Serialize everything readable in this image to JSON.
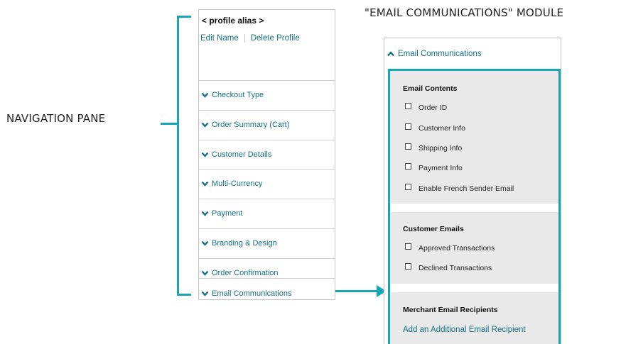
{
  "callouts": {
    "module_label": "\"EMAIL COMMUNICATIONS\" MODULE",
    "nav_label": "NAVIGATION PANE"
  },
  "colors": {
    "accent": "#16a6b6",
    "link": "#137184",
    "section_bg": "#e9e9e9"
  },
  "nav": {
    "profile_alias": "< profile alias >",
    "edit_name": "Edit Name",
    "delete_profile": "Delete Profile",
    "items": [
      {
        "label": "Checkout Type",
        "icon": "chevron-down-icon"
      },
      {
        "label": "Order Summary (Cart)",
        "icon": "chevron-down-icon"
      },
      {
        "label": "Customer Details",
        "icon": "chevron-down-icon"
      },
      {
        "label": "Multi-Currency",
        "icon": "chevron-down-icon"
      },
      {
        "label": "Payment",
        "icon": "chevron-down-icon"
      },
      {
        "label": "Branding & Design",
        "icon": "chevron-down-icon"
      },
      {
        "label": "Order Confirmation",
        "icon": "chevron-down-icon"
      },
      {
        "label": "Email Communications",
        "icon": "chevron-down-icon"
      }
    ]
  },
  "module": {
    "header": "Email Communications",
    "header_icon": "chevron-up-icon",
    "email_contents": {
      "title": "Email Contents",
      "options": [
        {
          "label": "Order ID",
          "checked": false
        },
        {
          "label": "Customer Info",
          "checked": false
        },
        {
          "label": "Shipping Info",
          "checked": false
        },
        {
          "label": "Payment Info",
          "checked": false
        },
        {
          "label": "Enable French Sender Email",
          "checked": false
        }
      ]
    },
    "customer_emails": {
      "title": "Customer Emails",
      "options": [
        {
          "label": "Approved Transactions",
          "checked": false
        },
        {
          "label": "Declined Transactions",
          "checked": false
        }
      ]
    },
    "merchant_recipients": {
      "title": "Merchant Email Recipients",
      "add_link": "Add an Additional Email Recipient"
    }
  }
}
